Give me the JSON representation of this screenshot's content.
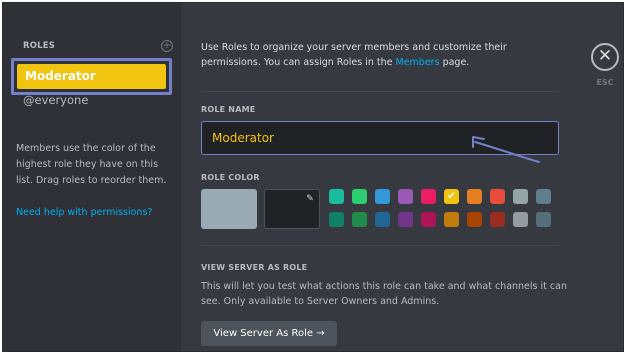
{
  "sidebar": {
    "title": "ROLES",
    "add_icon": "+",
    "selected_role": "Moderator",
    "other_role": "@everyone",
    "help_text": "Members use the color of the highest role they have on this list. Drag roles to reorder them.",
    "permissions_link": "Need help with permissions?"
  },
  "main": {
    "intro_before": "Use Roles to organize your server members and customize their permissions. You can assign Roles in the ",
    "intro_link": "Members",
    "intro_after": " page.",
    "role_name_label": "ROLE NAME",
    "role_name_value": "Moderator",
    "role_color_label": "ROLE COLOR",
    "picker_icon": "✎",
    "view_label": "VIEW SERVER AS ROLE",
    "view_description": "This will let you test what actions this role can take and what channels it can see. Only available to Server Owners and Admins.",
    "view_button": "View Server As Role →"
  },
  "close": {
    "icon": "✕",
    "label": "ESC"
  },
  "colors": {
    "accent": "#7480c9",
    "selected_role": "#f1c40f",
    "default_color": "#99aab5",
    "swatches_row1": [
      "#1abc9c",
      "#2ecc71",
      "#3498db",
      "#9b59b6",
      "#e91e63",
      "#f1c40f",
      "#e67e22",
      "#e74c3c",
      "#95a5a6",
      "#607d8b"
    ],
    "swatches_row2": [
      "#11806a",
      "#1f8b4c",
      "#206694",
      "#71368a",
      "#ad1457",
      "#c27c0e",
      "#a84300",
      "#992d22",
      "#979c9f",
      "#546e7a"
    ],
    "selected_swatch": "#f1c40f"
  }
}
